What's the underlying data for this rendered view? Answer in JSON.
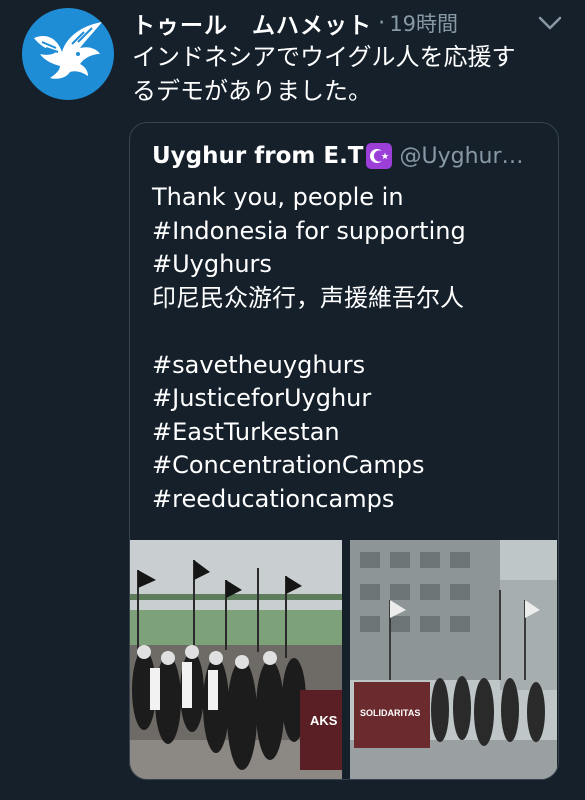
{
  "tweet": {
    "author_name": "トゥール　ムハメット",
    "separator": "·",
    "time": "19時間",
    "text_lines": [
      "インドネシアでウイグル人を応援す",
      "るデモがありました。"
    ]
  },
  "quote": {
    "author_name": "Uyghur from E.T",
    "handle": "@Uyghur…",
    "lines": [
      "Thank you, people in",
      "#Indonesia for supporting",
      "#Uyghurs",
      "印尼民众游行，声援維吾尔人",
      "",
      "#savetheuyghurs",
      "#JusticeforUyghur",
      "#EastTurkestan",
      "#ConcentrationCamps",
      "#reeducationcamps"
    ],
    "photo_banners": [
      "AKS",
      "SOLIDARITAS"
    ]
  },
  "colors": {
    "background": "#15202b",
    "text": "#ffffff",
    "muted": "#8899a6",
    "border": "#38444d",
    "avatar_bg": "#1f8dd6",
    "badge": "#9c3fd8"
  },
  "icons": [
    "eagle-logo",
    "chevron-down-icon",
    "star-crescent-icon"
  ]
}
